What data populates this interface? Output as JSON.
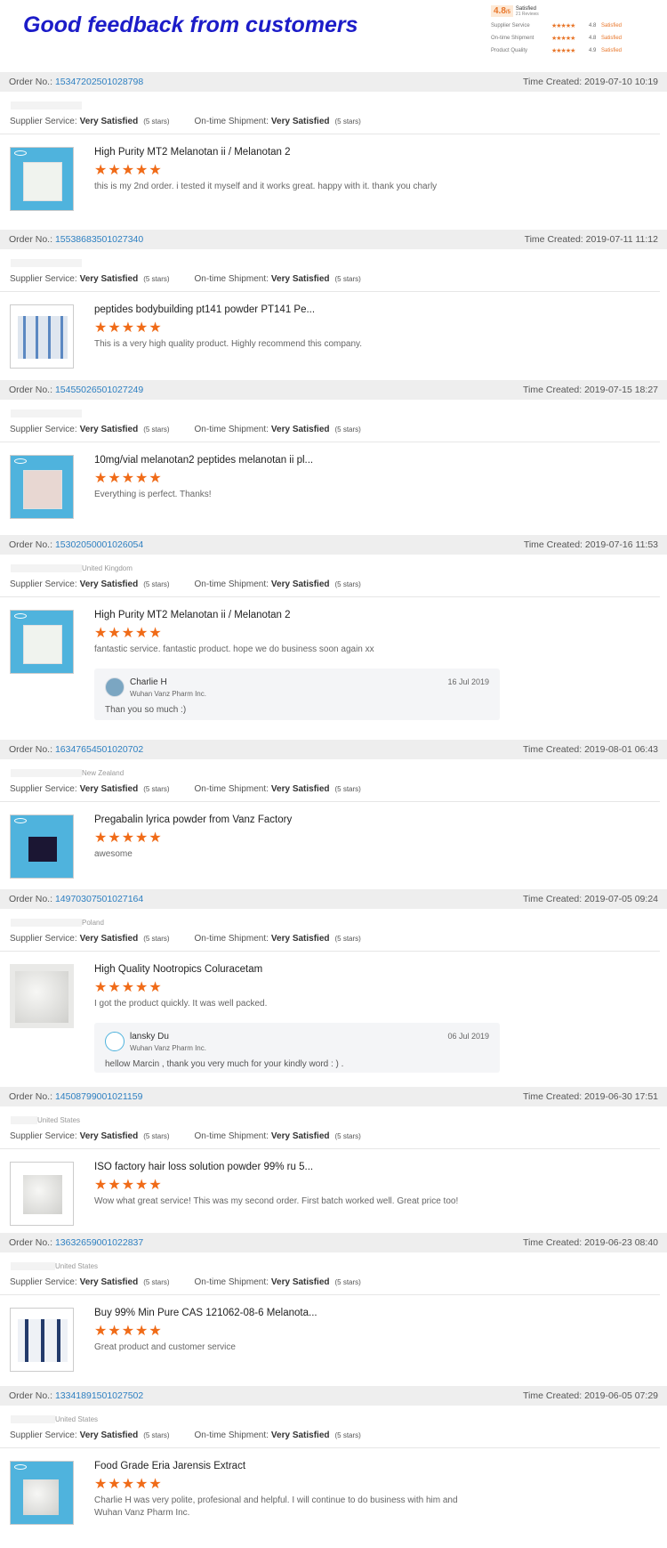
{
  "header": {
    "title": "Good feedback from customers",
    "score": "4.8",
    "score_suffix": "/5",
    "score_label": "Satisfied",
    "review_count": "21 Reviews",
    "rows": [
      {
        "name": "Supplier Service",
        "value": "4.8",
        "status": "Satisfied"
      },
      {
        "name": "On-time Shipment",
        "value": "4.8",
        "status": "Satisfied"
      },
      {
        "name": "Product Quality",
        "value": "4.9",
        "status": "Satisfied"
      }
    ]
  },
  "labels": {
    "order_no": "Order No.:",
    "time_created": "Time Created:",
    "supplier_service": "Supplier Service:",
    "ontime_shipment": "On-time Shipment:",
    "very_satisfied": "Very Satisfied",
    "five_stars": "(5 stars)",
    "stars": "★★★★★"
  },
  "orders": [
    {
      "order_no": "15347202501028798",
      "time": "2019-07-10 10:19",
      "country": "",
      "product": "High Purity MT2 Melanotan ii / Melanotan 2",
      "comment": "this is my 2nd order. i tested it myself and it works great. happy with it. thank you charly"
    },
    {
      "order_no": "15538683501027340",
      "time": "2019-07-11 11:12",
      "country": "",
      "product": "peptides bodybuilding pt141 powder PT141 Pe...",
      "comment": "This is a very high quality product. Highly recommend this company."
    },
    {
      "order_no": "15455026501027249",
      "time": "2019-07-15 18:27",
      "country": "",
      "product": "10mg/vial melanotan2 peptides melanotan ii pl...",
      "comment": "Everything is perfect. Thanks!"
    },
    {
      "order_no": "15302050001026054",
      "time": "2019-07-16 11:53",
      "country": "United Kingdom",
      "product": "High Purity MT2 Melanotan ii / Melanotan 2",
      "comment": "fantastic service.  fantastic product.  hope we do business soon again xx",
      "reply": {
        "name": "Charlie H",
        "company": "Wuhan Vanz Pharm Inc.",
        "date": "16 Jul 2019",
        "text": "Than you so much :)"
      }
    },
    {
      "order_no": "16347654501020702",
      "time": "2019-08-01 06:43",
      "country": "New Zealand",
      "product": "Pregabalin lyrica powder from Vanz Factory",
      "comment": "awesome"
    },
    {
      "order_no": "14970307501027164",
      "time": "2019-07-05 09:24",
      "country": "Poland",
      "product": "High Quality Nootropics Coluracetam",
      "comment": "I got the product quickly. It was well packed.",
      "reply": {
        "name": "lansky Du",
        "company": "Wuhan Vanz Pharm Inc.",
        "date": "06 Jul 2019",
        "text": "hellow Marcin , thank you very much for your kindly word : ) ."
      }
    },
    {
      "order_no": "14508799001021159",
      "time": "2019-06-30 17:51",
      "country": "United States",
      "product": "ISO factory hair loss solution powder 99% ru 5...",
      "comment": "Wow what great service! This was my second order. First batch worked well. Great price too!"
    },
    {
      "order_no": "13632659001022837",
      "time": "2019-06-23 08:40",
      "country": "United States",
      "product": "Buy 99% Min Pure CAS 121062-08-6 Melanota...",
      "comment": "Great product and customer service"
    },
    {
      "order_no": "13341891501027502",
      "time": "2019-06-05 07:29",
      "country": "United States",
      "product": "Food Grade Eria Jarensis Extract",
      "comment": "Charlie H was very polite, profesional and helpful. I will continue to do business with him and Wuhan Vanz Pharm Inc."
    }
  ]
}
